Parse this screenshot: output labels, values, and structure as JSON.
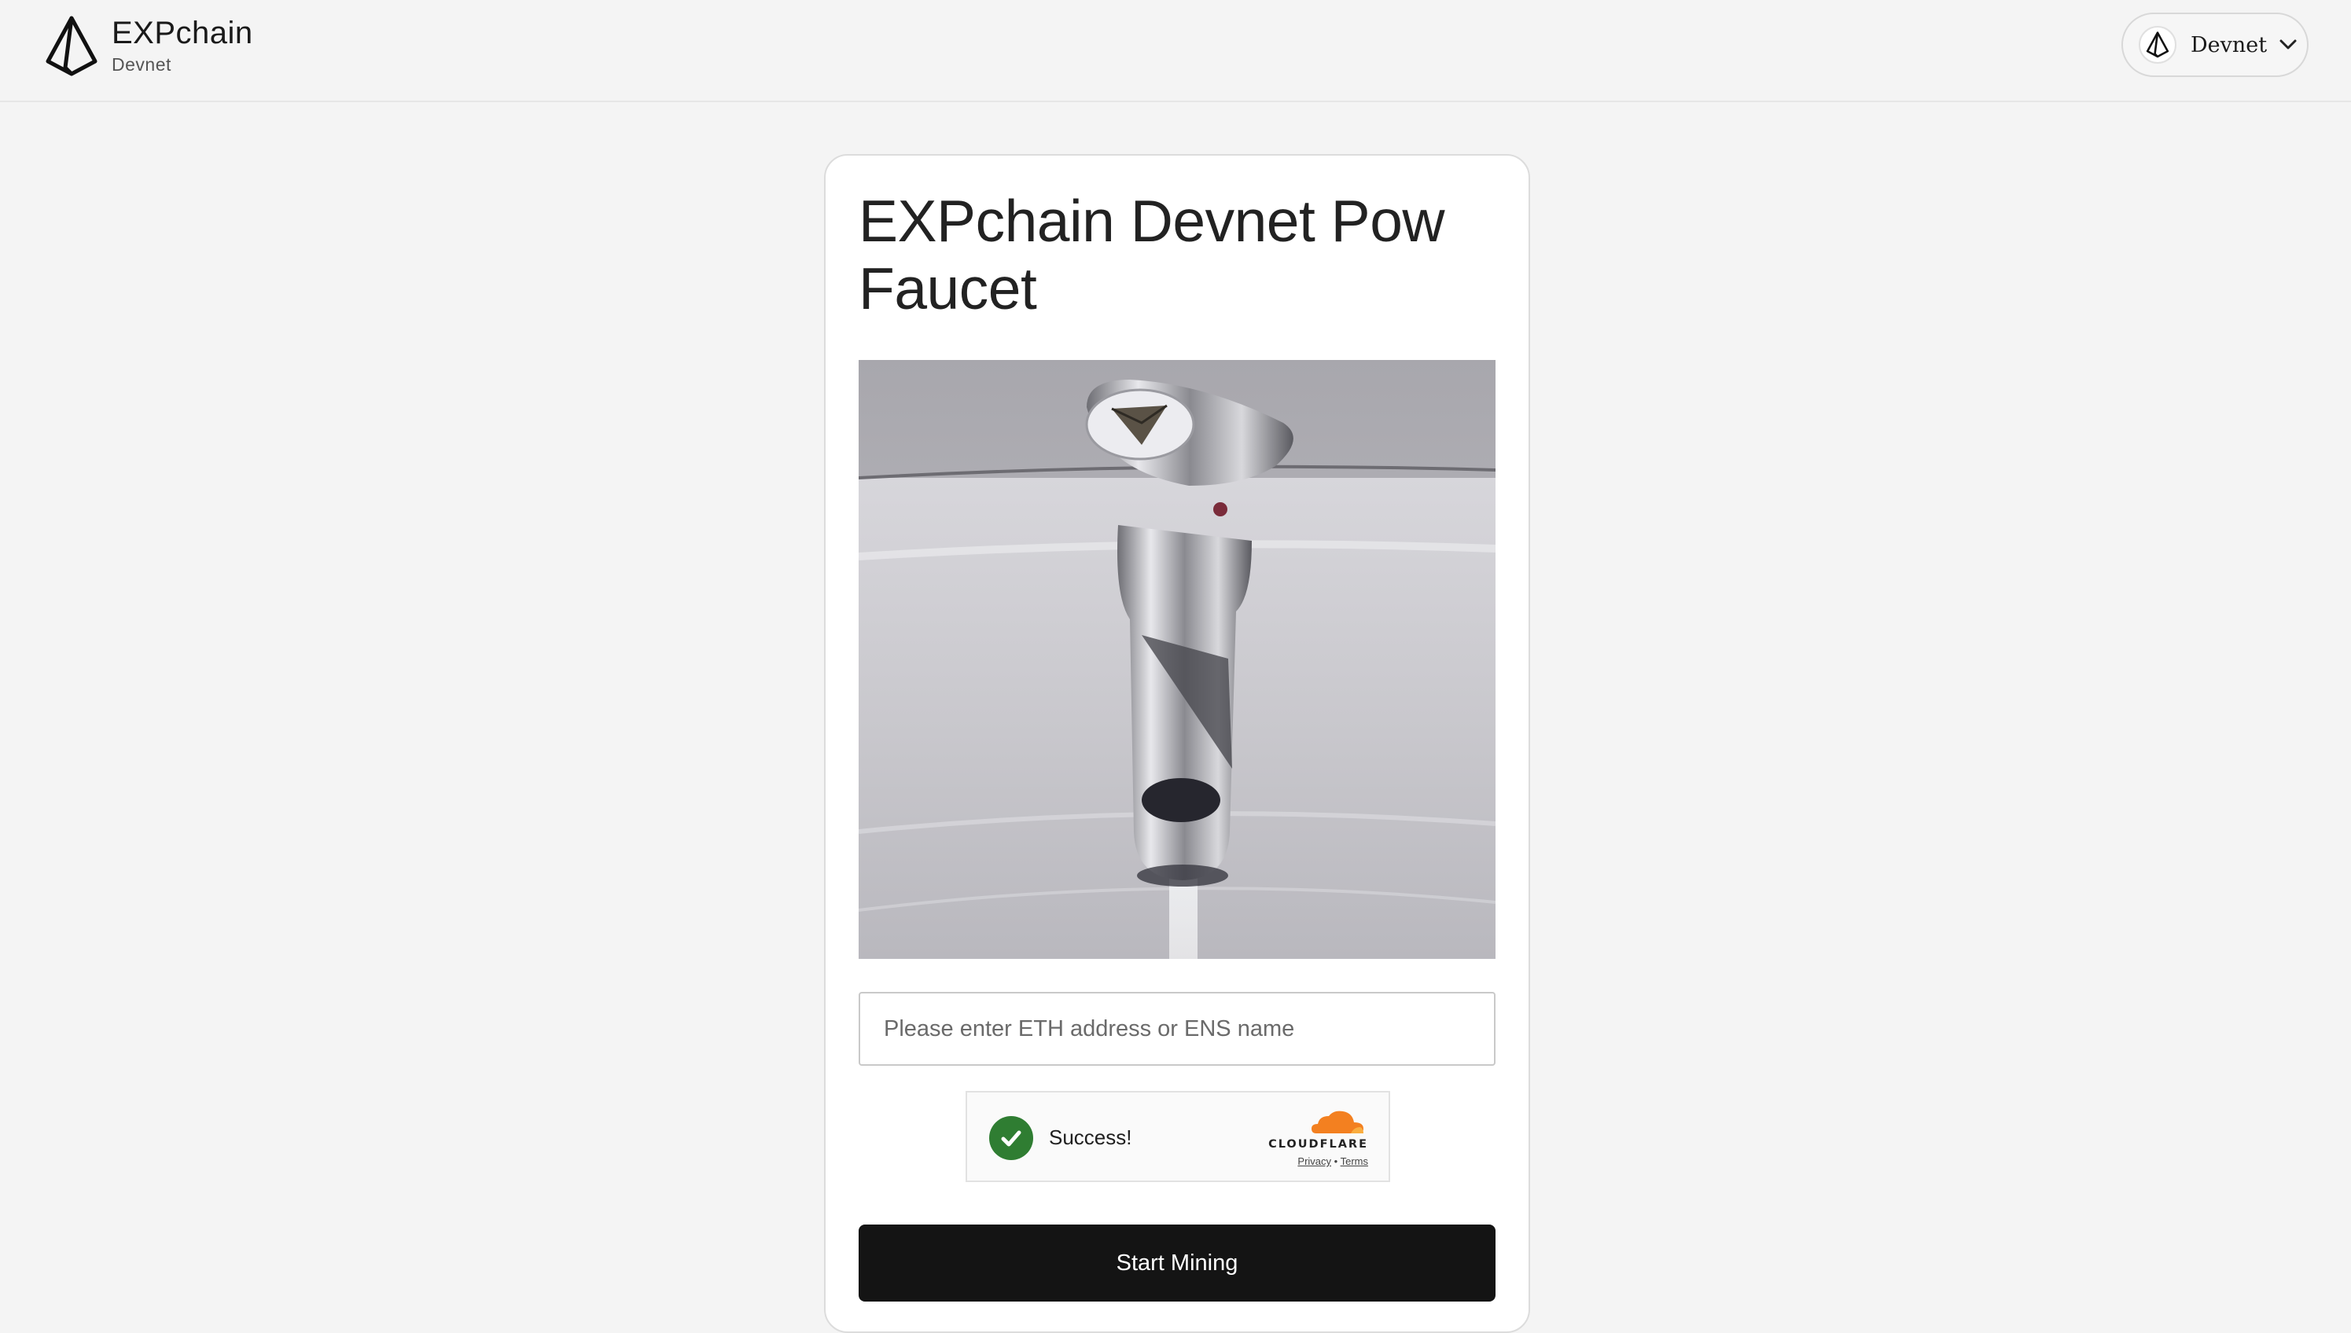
{
  "header": {
    "brand_name": "EXPchain",
    "brand_subtitle": "Devnet",
    "network_selector": {
      "selected": "Devnet"
    }
  },
  "card": {
    "title": "EXPchain Devnet Pow Faucet",
    "image_alt": "Chrome faucet with Ethereum logo on the handle",
    "address_input": {
      "value": "",
      "placeholder": "Please enter ETH address or ENS name"
    },
    "captcha": {
      "status": "Success!",
      "provider": "CLOUDFLARE",
      "privacy_link": "Privacy",
      "separator": "•",
      "terms_link": "Terms"
    },
    "start_button": "Start Mining"
  },
  "colors": {
    "page_bg": "#f4f4f4",
    "card_bg": "#ffffff",
    "button_bg": "#141414",
    "captcha_success": "#2f7d32",
    "cloudflare_orange": "#f38020"
  },
  "icons": {
    "brand_logo": "expchain-logo-icon",
    "network_logo": "expchain-logo-icon",
    "dropdown": "chevron-down-icon",
    "captcha_check": "checkmark-icon",
    "cloudflare": "cloudflare-cloud-icon"
  }
}
